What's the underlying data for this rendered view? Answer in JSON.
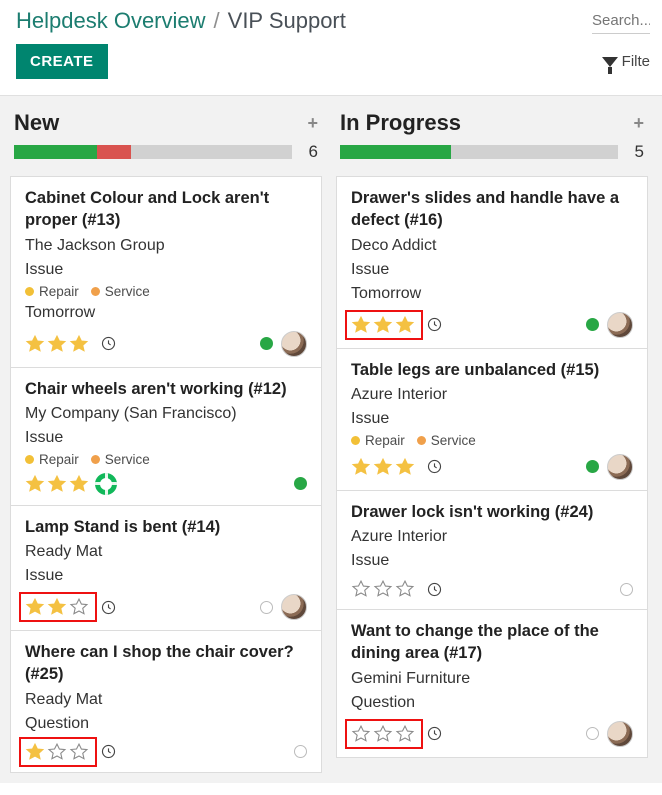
{
  "breadcrumb": {
    "root": "Helpdesk Overview",
    "leaf": "VIP Support"
  },
  "search_placeholder": "Search...",
  "create_label": "CREATE",
  "filters_label": "Filte",
  "columns": [
    {
      "title": "New",
      "count": "6",
      "progress": [
        {
          "color": "green",
          "pct": 30
        },
        {
          "color": "red",
          "pct": 12
        }
      ],
      "cards": [
        {
          "title": "Cabinet Colour and Lock aren't proper (#13)",
          "customer": "The Jackson Group",
          "type": "Issue",
          "tags": [
            "Repair",
            "Service"
          ],
          "due": "Tomorrow",
          "stars_filled": 3,
          "stars_total": 3,
          "highlight_stars": false,
          "clock": true,
          "status": "green",
          "avatar": true,
          "lifering": false
        },
        {
          "title": "Chair wheels aren't working (#12)",
          "customer": "My Company (San Francisco)",
          "type": "Issue",
          "tags": [
            "Repair",
            "Service"
          ],
          "due": null,
          "stars_filled": 3,
          "stars_total": 3,
          "highlight_stars": false,
          "clock": false,
          "status": "green",
          "avatar": false,
          "lifering": true
        },
        {
          "title": "Lamp Stand is bent (#14)",
          "customer": "Ready Mat",
          "type": "Issue",
          "tags": [],
          "due": null,
          "stars_filled": 2,
          "stars_total": 3,
          "highlight_stars": true,
          "clock": true,
          "status": "none",
          "avatar": true,
          "lifering": false
        },
        {
          "title": "Where can I shop the chair cover? (#25)",
          "customer": "Ready Mat",
          "type": "Question",
          "tags": [],
          "due": null,
          "stars_filled": 1,
          "stars_total": 3,
          "highlight_stars": true,
          "clock": true,
          "status": "none",
          "avatar": false,
          "lifering": false
        }
      ]
    },
    {
      "title": "In Progress",
      "count": "5",
      "progress": [
        {
          "color": "green",
          "pct": 40
        }
      ],
      "cards": [
        {
          "title": "Drawer's slides and handle have a defect (#16)",
          "customer": "Deco Addict",
          "type": "Issue",
          "tags": [],
          "due": "Tomorrow",
          "stars_filled": 3,
          "stars_total": 3,
          "highlight_stars": true,
          "clock": true,
          "status": "green",
          "avatar": true,
          "lifering": false
        },
        {
          "title": "Table legs are unbalanced (#15)",
          "customer": "Azure Interior",
          "type": "Issue",
          "tags": [
            "Repair",
            "Service"
          ],
          "due": null,
          "stars_filled": 3,
          "stars_total": 3,
          "highlight_stars": false,
          "clock": true,
          "status": "green",
          "avatar": true,
          "lifering": false
        },
        {
          "title": "Drawer lock isn't working (#24)",
          "customer": "Azure Interior",
          "type": "Issue",
          "tags": [],
          "due": null,
          "stars_filled": 0,
          "stars_total": 3,
          "highlight_stars": false,
          "clock": true,
          "status": "none",
          "avatar": false,
          "lifering": false
        },
        {
          "title": "Want to change the place of the dining area (#17)",
          "customer": "Gemini Furniture",
          "type": "Question",
          "tags": [],
          "due": null,
          "stars_filled": 0,
          "stars_total": 3,
          "highlight_stars": true,
          "clock": true,
          "status": "none",
          "avatar": true,
          "lifering": false
        }
      ]
    }
  ],
  "tag_labels": {
    "Repair": "Repair",
    "Service": "Service"
  }
}
